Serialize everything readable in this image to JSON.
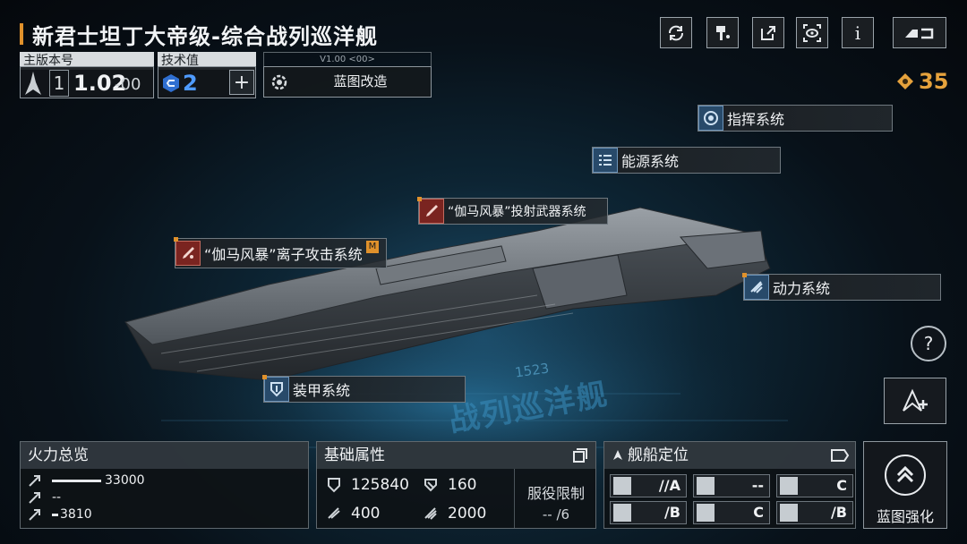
{
  "title": "新君士坦丁大帝级-综合战列巡洋舰",
  "top_buttons": {
    "refresh_icon": "refresh-icon",
    "paint_icon": "paint-icon",
    "share_icon": "share-icon",
    "view_icon": "view-icon",
    "info_label": "i",
    "back_icon": "back-icon"
  },
  "version_panel": {
    "label": "主版本号",
    "major": "1",
    "minor": "1.02",
    "patch": "-00"
  },
  "tech_panel": {
    "label": "技术值",
    "value": "2",
    "add_label": "+"
  },
  "blueprint": {
    "version": "V1.00 <00>",
    "label": "蓝图改造"
  },
  "currency": {
    "value": "35",
    "color": "#e6a23c"
  },
  "systems": {
    "command": "指挥系统",
    "energy": "能源系统",
    "projectile": "“伽马风暴”投射武器系统",
    "ion": "“伽马风暴”离子攻击系统",
    "ion_badge": "M",
    "power": "动力系统",
    "armor": "装甲系统"
  },
  "hull_markings": {
    "number": "1523",
    "class_text": "战列巡洋舰"
  },
  "firepower": {
    "title": "火力总览",
    "rows": [
      {
        "value": "33000",
        "fill": 1.0
      },
      {
        "value": "--",
        "fill": 0
      },
      {
        "value": "3810",
        "fill": 0.12
      }
    ]
  },
  "base_stats": {
    "title": "基础属性",
    "hp": "125840",
    "armor": "160",
    "shield": "400",
    "speed": "2000",
    "service_label": "服役限制",
    "service_value": "-- /6"
  },
  "positioning": {
    "title": "舰船定位",
    "cells": [
      {
        "value": "//A"
      },
      {
        "value": "--"
      },
      {
        "value": "C"
      },
      {
        "value": "/B"
      },
      {
        "value": "C"
      },
      {
        "value": "/B"
      }
    ]
  },
  "enhance": {
    "label": "蓝图强化"
  },
  "help_label": "?"
}
